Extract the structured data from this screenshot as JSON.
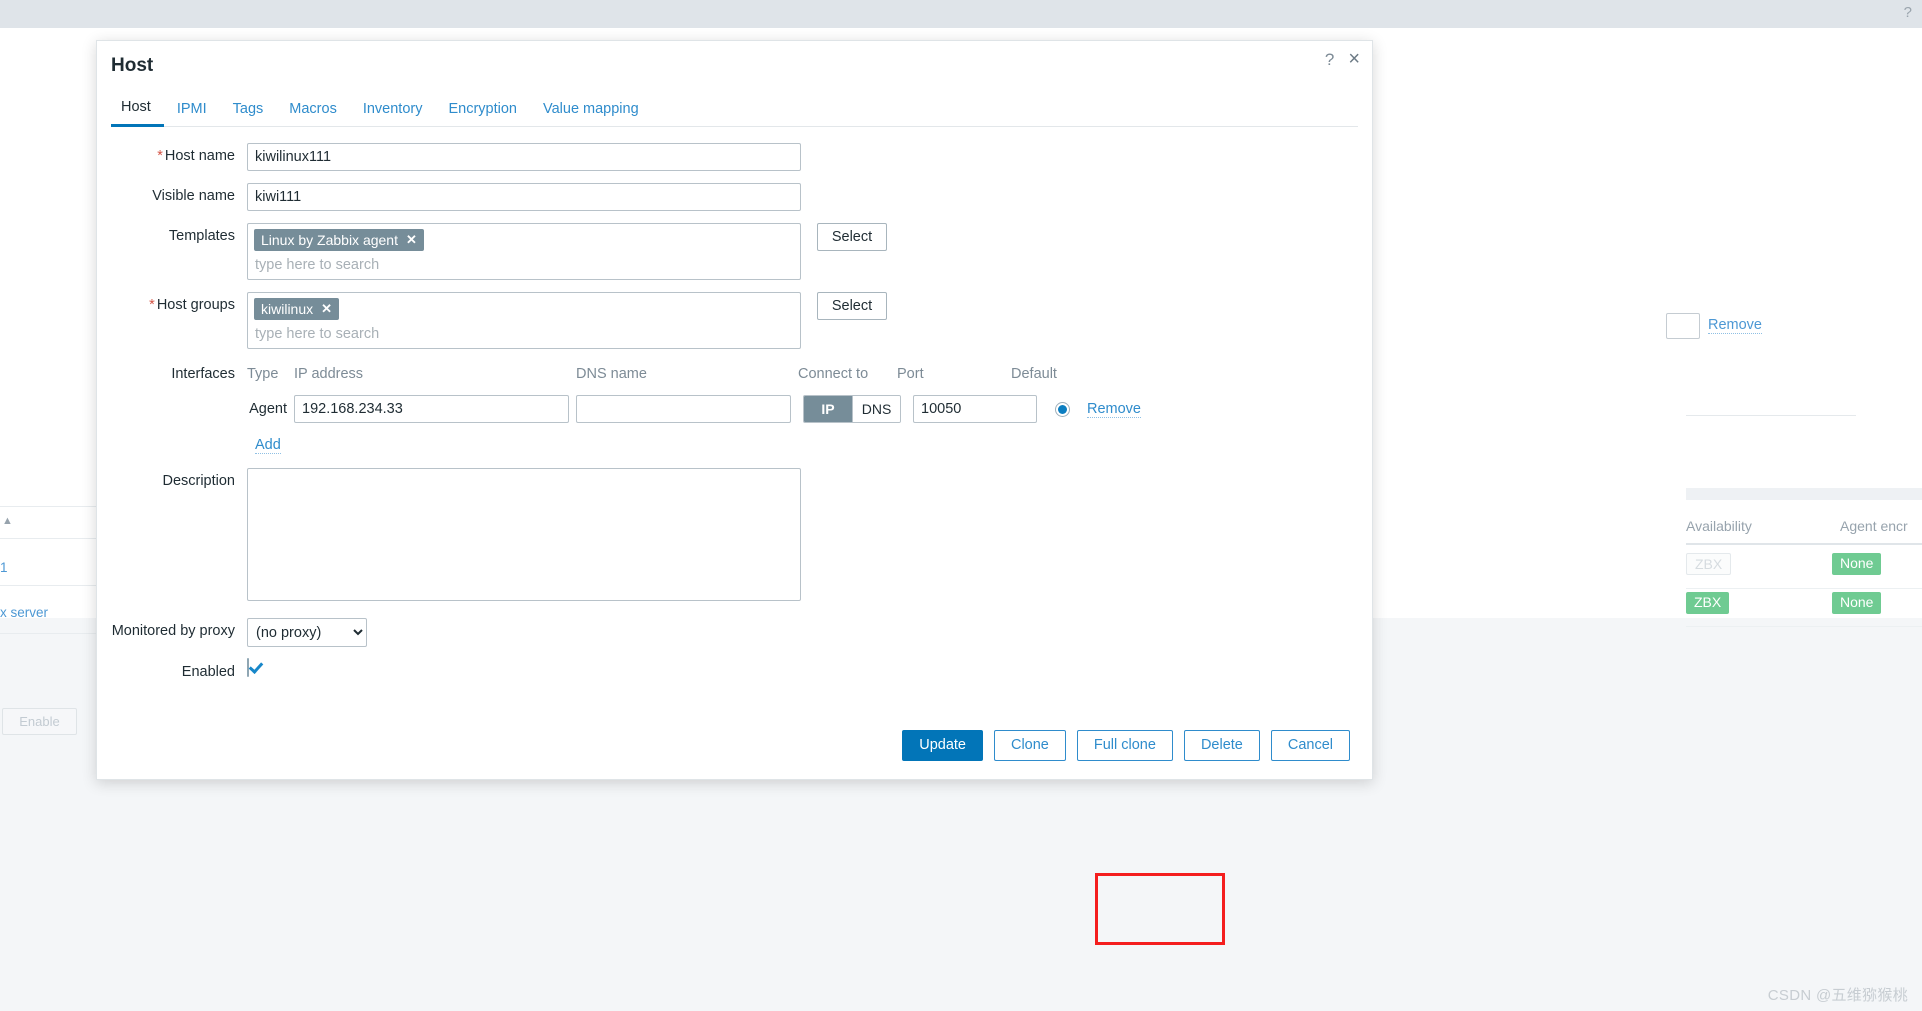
{
  "background": {
    "help_icon": "?",
    "sort_arrow_icon": "up-triangle-icon",
    "left_links": [
      "1",
      "x server"
    ],
    "disabled_button": "Enable",
    "remove_link": "Remove",
    "table_headers": [
      "Availability",
      "Agent encr"
    ],
    "rows": [
      {
        "availability": "ZBX",
        "availability_state": "off",
        "encryption": "None"
      },
      {
        "availability": "ZBX",
        "availability_state": "on",
        "encryption": "None"
      }
    ],
    "watermark": "CSDN @五维猕猴桃"
  },
  "modal": {
    "title": "Host",
    "help_icon": "?",
    "close_icon": "×",
    "tabs": [
      {
        "label": "Host",
        "active": true
      },
      {
        "label": "IPMI",
        "active": false
      },
      {
        "label": "Tags",
        "active": false
      },
      {
        "label": "Macros",
        "active": false
      },
      {
        "label": "Inventory",
        "active": false
      },
      {
        "label": "Encryption",
        "active": false
      },
      {
        "label": "Value mapping",
        "active": false
      }
    ],
    "form": {
      "host_name": {
        "label": "Host name",
        "required": true,
        "value": "kiwilinux111"
      },
      "visible_name": {
        "label": "Visible name",
        "required": false,
        "value": "kiwi111"
      },
      "templates": {
        "label": "Templates",
        "required": false,
        "chips": [
          "Linux by Zabbix agent"
        ],
        "placeholder": "type here to search",
        "select_label": "Select"
      },
      "host_groups": {
        "label": "Host groups",
        "required": true,
        "chips": [
          "kiwilinux"
        ],
        "placeholder": "type here to search",
        "select_label": "Select"
      },
      "interfaces": {
        "label": "Interfaces",
        "columns": [
          "Type",
          "IP address",
          "DNS name",
          "Connect to",
          "Port",
          "Default"
        ],
        "rows": [
          {
            "type": "Agent",
            "ip": "192.168.234.33",
            "dns": "",
            "connect_to": [
              "IP",
              "DNS"
            ],
            "connect_to_selected": "IP",
            "port": "10050",
            "default_selected": true,
            "remove_label": "Remove"
          }
        ],
        "add_label": "Add"
      },
      "description": {
        "label": "Description",
        "value": ""
      },
      "monitored_by_proxy": {
        "label": "Monitored by proxy",
        "value": "(no proxy)",
        "options": [
          "(no proxy)"
        ]
      },
      "enabled": {
        "label": "Enabled",
        "checked": true
      }
    },
    "footer": {
      "update": "Update",
      "clone": "Clone",
      "full_clone": "Full clone",
      "delete": "Delete",
      "cancel": "Cancel"
    }
  },
  "colors": {
    "primary": "#0275b8",
    "link": "#2f8ccc",
    "chip": "#768d99",
    "required": "#d45345",
    "highlight": "#f41e1e",
    "badge_green": "#6fcb92"
  }
}
